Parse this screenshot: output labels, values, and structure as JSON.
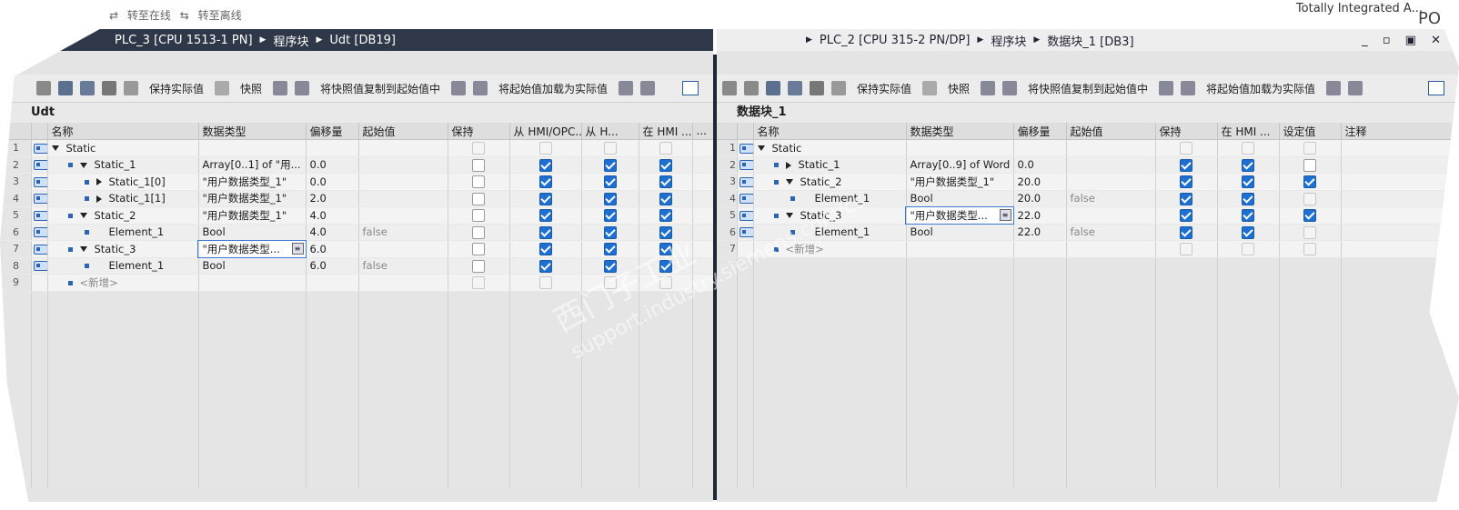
{
  "top_menu": [
    "转至在线",
    "转至离线"
  ],
  "brand": "Totally Integrated A...",
  "brand_short": "PO",
  "window_controls": "_ ▫ ▣ ✕",
  "left": {
    "breadcrumb": [
      "PLC_3 [CPU 1513-1 PN]",
      "程序块",
      "Udt [DB19]"
    ],
    "toolbar": {
      "keep_actual": "保持实际值",
      "snapshot": "快照",
      "copy_snapshot": "将快照值复制到起始值中",
      "load_start": "将起始值加载为实际值"
    },
    "block_name": "Udt",
    "columns": [
      "名称",
      "数据类型",
      "偏移量",
      "起始值",
      "保持",
      "从 HMI/OPC...",
      "从 H...",
      "在 HMI ...",
      "..."
    ],
    "rows": [
      {
        "n": "1",
        "indent": 0,
        "expander": "down",
        "name": "Static",
        "type": "",
        "offset": "",
        "start": "",
        "checks": [
          "faint",
          "faint",
          "faint",
          "faint"
        ]
      },
      {
        "n": "2",
        "indent": 1,
        "expander": "down",
        "name": "Static_1",
        "type": "Array[0..1] of \"用...",
        "offset": "0.0",
        "start": "",
        "checks": [
          "off",
          "on",
          "on",
          "on"
        ]
      },
      {
        "n": "3",
        "indent": 2,
        "expander": "right",
        "name": "Static_1[0]",
        "type": "\"用户数据类型_1\"",
        "offset": "0.0",
        "start": "",
        "checks": [
          "off",
          "on",
          "on",
          "on"
        ]
      },
      {
        "n": "4",
        "indent": 2,
        "expander": "right",
        "name": "Static_1[1]",
        "type": "\"用户数据类型_1\"",
        "offset": "2.0",
        "start": "",
        "checks": [
          "off",
          "on",
          "on",
          "on"
        ]
      },
      {
        "n": "5",
        "indent": 1,
        "expander": "down",
        "name": "Static_2",
        "type": "\"用户数据类型_1\"",
        "offset": "4.0",
        "start": "",
        "checks": [
          "off",
          "on",
          "on",
          "on"
        ]
      },
      {
        "n": "6",
        "indent": 2,
        "expander": "none",
        "name": "Element_1",
        "type": "Bool",
        "offset": "4.0",
        "start": "false",
        "checks": [
          "off",
          "on",
          "on",
          "on"
        ]
      },
      {
        "n": "7",
        "indent": 1,
        "expander": "down",
        "name": "Static_3",
        "type": "\"用户数据类型...",
        "offset": "6.0",
        "start": "",
        "checks": [
          "off",
          "on",
          "on",
          "on"
        ],
        "editing": true
      },
      {
        "n": "8",
        "indent": 2,
        "expander": "none",
        "name": "Element_1",
        "type": "Bool",
        "offset": "6.0",
        "start": "false",
        "checks": [
          "off",
          "on",
          "on",
          "on"
        ]
      },
      {
        "n": "9",
        "indent": 1,
        "expander": "none",
        "name": "<新增>",
        "type": "",
        "offset": "",
        "start": "",
        "checks": [
          "faint",
          "faint",
          "faint",
          "faint"
        ],
        "add": true
      }
    ]
  },
  "right": {
    "breadcrumb": [
      "PLC_2 [CPU 315-2 PN/DP]",
      "程序块",
      "数据块_1 [DB3]"
    ],
    "toolbar": {
      "keep_actual": "保持实际值",
      "snapshot": "快照",
      "copy_snapshot": "将快照值复制到起始值中",
      "load_start": "将起始值加载为实际值"
    },
    "block_name": "数据块_1",
    "columns": [
      "名称",
      "数据类型",
      "偏移量",
      "起始值",
      "保持",
      "在 HMI ...",
      "设定值",
      "注释"
    ],
    "rows": [
      {
        "n": "1",
        "indent": 0,
        "expander": "down",
        "name": "Static",
        "type": "",
        "offset": "",
        "start": "",
        "checks": [
          "faint",
          "faint",
          "faint"
        ]
      },
      {
        "n": "2",
        "indent": 1,
        "expander": "right",
        "name": "Static_1",
        "type": "Array[0..9] of Word",
        "offset": "0.0",
        "start": "",
        "checks": [
          "on",
          "on",
          "off"
        ]
      },
      {
        "n": "3",
        "indent": 1,
        "expander": "down",
        "name": "Static_2",
        "type": "\"用户数据类型_1\"",
        "offset": "20.0",
        "start": "",
        "checks": [
          "on",
          "on",
          "on"
        ]
      },
      {
        "n": "4",
        "indent": 2,
        "expander": "none",
        "name": "Element_1",
        "type": "Bool",
        "offset": "20.0",
        "start": "false",
        "checks": [
          "on",
          "on",
          "faint"
        ]
      },
      {
        "n": "5",
        "indent": 1,
        "expander": "down",
        "name": "Static_3",
        "type": "\"用户数据类型...",
        "offset": "22.0",
        "start": "",
        "checks": [
          "on",
          "on",
          "on"
        ],
        "editing": true
      },
      {
        "n": "6",
        "indent": 2,
        "expander": "none",
        "name": "Element_1",
        "type": "Bool",
        "offset": "22.0",
        "start": "false",
        "checks": [
          "on",
          "on",
          "faint"
        ]
      },
      {
        "n": "7",
        "indent": 1,
        "expander": "none",
        "name": "<新增>",
        "type": "",
        "offset": "",
        "start": "",
        "checks": [
          "faint",
          "faint",
          "faint"
        ],
        "add": true
      }
    ]
  },
  "watermark": [
    "西门子工业",
    "support.industry.siemens.com/cs"
  ]
}
